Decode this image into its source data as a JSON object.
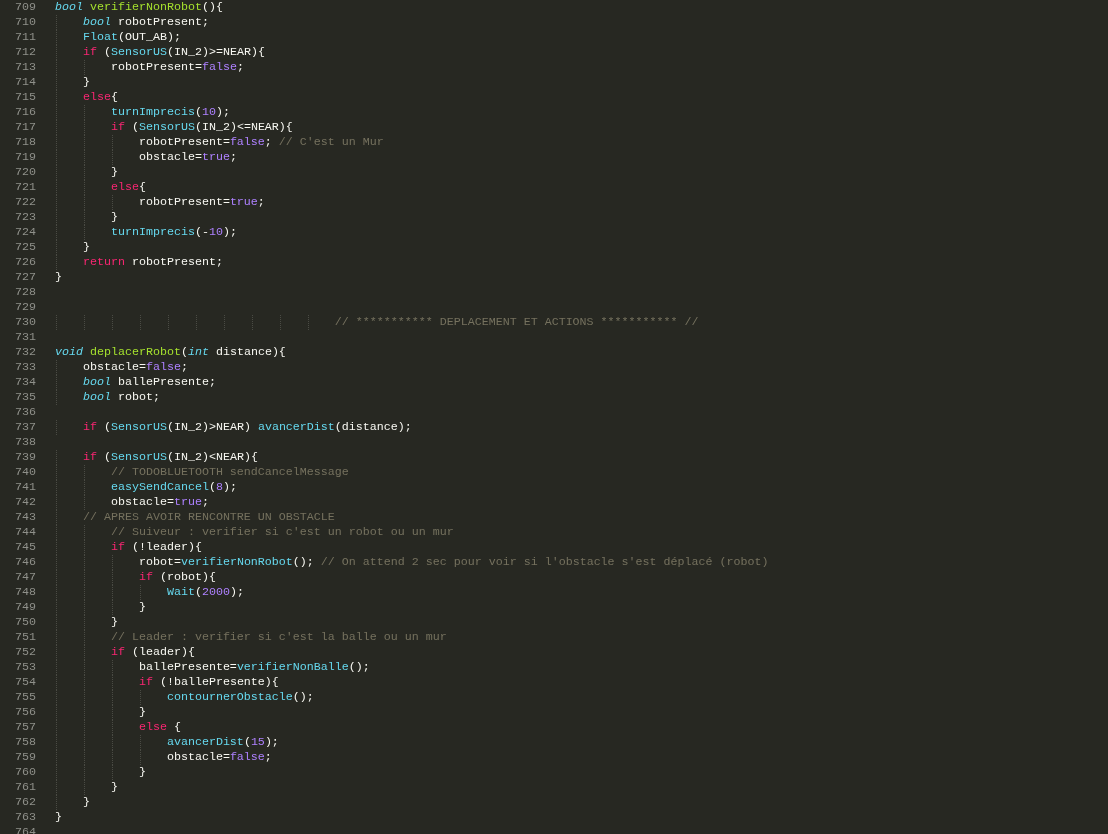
{
  "editor": {
    "lines": [
      {
        "number": "709",
        "tokens": [
          {
            "kind": "type",
            "text": "bool"
          },
          {
            "kind": "def",
            "text": " verifierNonRobot"
          },
          {
            "kind": "plain",
            "text": "(){"
          }
        ]
      },
      {
        "number": "710",
        "tokens": [
          {
            "kind": "type",
            "text": "    bool"
          },
          {
            "kind": "plain",
            "text": " robotPresent;"
          }
        ]
      },
      {
        "number": "711",
        "tokens": [
          {
            "kind": "fn",
            "text": "    Float"
          },
          {
            "kind": "plain",
            "text": "(OUT_AB);"
          }
        ]
      },
      {
        "number": "712",
        "tokens": [
          {
            "kind": "kw",
            "text": "    if"
          },
          {
            "kind": "plain",
            "text": " ("
          },
          {
            "kind": "fn",
            "text": "SensorUS"
          },
          {
            "kind": "plain",
            "text": "(IN_2)>=NEAR){"
          }
        ]
      },
      {
        "number": "713",
        "tokens": [
          {
            "kind": "plain",
            "text": "        robotPresent="
          },
          {
            "kind": "const",
            "text": "false"
          },
          {
            "kind": "plain",
            "text": ";"
          }
        ]
      },
      {
        "number": "714",
        "tokens": [
          {
            "kind": "plain",
            "text": "    }"
          }
        ]
      },
      {
        "number": "715",
        "tokens": [
          {
            "kind": "kw",
            "text": "    else"
          },
          {
            "kind": "plain",
            "text": "{"
          }
        ]
      },
      {
        "number": "716",
        "tokens": [
          {
            "kind": "fn",
            "text": "        turnImprecis"
          },
          {
            "kind": "plain",
            "text": "("
          },
          {
            "kind": "const",
            "text": "10"
          },
          {
            "kind": "plain",
            "text": ");"
          }
        ]
      },
      {
        "number": "717",
        "tokens": [
          {
            "kind": "kw",
            "text": "        if"
          },
          {
            "kind": "plain",
            "text": " ("
          },
          {
            "kind": "fn",
            "text": "SensorUS"
          },
          {
            "kind": "plain",
            "text": "(IN_2)<=NEAR){"
          }
        ]
      },
      {
        "number": "718",
        "tokens": [
          {
            "kind": "plain",
            "text": "            robotPresent="
          },
          {
            "kind": "const",
            "text": "false"
          },
          {
            "kind": "plain",
            "text": "; "
          },
          {
            "kind": "comment",
            "text": "// C'est un Mur"
          }
        ]
      },
      {
        "number": "719",
        "tokens": [
          {
            "kind": "plain",
            "text": "            obstacle="
          },
          {
            "kind": "const",
            "text": "true"
          },
          {
            "kind": "plain",
            "text": ";"
          }
        ]
      },
      {
        "number": "720",
        "tokens": [
          {
            "kind": "plain",
            "text": "        }"
          }
        ]
      },
      {
        "number": "721",
        "tokens": [
          {
            "kind": "kw",
            "text": "        else"
          },
          {
            "kind": "plain",
            "text": "{"
          }
        ]
      },
      {
        "number": "722",
        "tokens": [
          {
            "kind": "plain",
            "text": "            robotPresent="
          },
          {
            "kind": "const",
            "text": "true"
          },
          {
            "kind": "plain",
            "text": ";"
          }
        ]
      },
      {
        "number": "723",
        "tokens": [
          {
            "kind": "plain",
            "text": "        }"
          }
        ]
      },
      {
        "number": "724",
        "tokens": [
          {
            "kind": "fn",
            "text": "        turnImprecis"
          },
          {
            "kind": "plain",
            "text": "(-"
          },
          {
            "kind": "const",
            "text": "10"
          },
          {
            "kind": "plain",
            "text": ");"
          }
        ]
      },
      {
        "number": "725",
        "tokens": [
          {
            "kind": "plain",
            "text": "    }"
          }
        ]
      },
      {
        "number": "726",
        "tokens": [
          {
            "kind": "kw",
            "text": "    return"
          },
          {
            "kind": "plain",
            "text": " robotPresent;"
          }
        ]
      },
      {
        "number": "727",
        "tokens": [
          {
            "kind": "plain",
            "text": "}"
          }
        ]
      },
      {
        "number": "728"
      },
      {
        "number": "729"
      },
      {
        "number": "730",
        "tokens": [
          {
            "kind": "comment",
            "text": "                                        // *********** DEPLACEMENT ET ACTIONS *********** //"
          }
        ]
      },
      {
        "number": "731"
      },
      {
        "number": "732",
        "tokens": [
          {
            "kind": "type",
            "text": "void"
          },
          {
            "kind": "def",
            "text": " deplacerRobot"
          },
          {
            "kind": "plain",
            "text": "("
          },
          {
            "kind": "type",
            "text": "int"
          },
          {
            "kind": "plain",
            "text": " distance){"
          }
        ]
      },
      {
        "number": "733",
        "tokens": [
          {
            "kind": "plain",
            "text": "    obstacle="
          },
          {
            "kind": "const",
            "text": "false"
          },
          {
            "kind": "plain",
            "text": ";"
          }
        ]
      },
      {
        "number": "734",
        "tokens": [
          {
            "kind": "type",
            "text": "    bool"
          },
          {
            "kind": "plain",
            "text": " ballePresente;"
          }
        ]
      },
      {
        "number": "735",
        "tokens": [
          {
            "kind": "type",
            "text": "    bool"
          },
          {
            "kind": "plain",
            "text": " robot;"
          }
        ]
      },
      {
        "number": "736"
      },
      {
        "number": "737",
        "tokens": [
          {
            "kind": "kw",
            "text": "    if"
          },
          {
            "kind": "plain",
            "text": " ("
          },
          {
            "kind": "fn",
            "text": "SensorUS"
          },
          {
            "kind": "plain",
            "text": "(IN_2)>NEAR) "
          },
          {
            "kind": "fn",
            "text": "avancerDist"
          },
          {
            "kind": "plain",
            "text": "(distance);"
          }
        ]
      },
      {
        "number": "738"
      },
      {
        "number": "739",
        "tokens": [
          {
            "kind": "kw",
            "text": "    if"
          },
          {
            "kind": "plain",
            "text": " ("
          },
          {
            "kind": "fn",
            "text": "SensorUS"
          },
          {
            "kind": "plain",
            "text": "(IN_2)<NEAR){"
          }
        ]
      },
      {
        "number": "740",
        "tokens": [
          {
            "kind": "comment",
            "text": "        // TODOBLUETOOTH sendCancelMessage"
          }
        ]
      },
      {
        "number": "741",
        "tokens": [
          {
            "kind": "fn",
            "text": "        easySendCancel"
          },
          {
            "kind": "plain",
            "text": "("
          },
          {
            "kind": "const",
            "text": "8"
          },
          {
            "kind": "plain",
            "text": ");"
          }
        ]
      },
      {
        "number": "742",
        "tokens": [
          {
            "kind": "plain",
            "text": "        obstacle="
          },
          {
            "kind": "const",
            "text": "true"
          },
          {
            "kind": "plain",
            "text": ";"
          }
        ]
      },
      {
        "number": "743",
        "tokens": [
          {
            "kind": "comment",
            "text": "    // APRES AVOIR RENCONTRE UN OBSTACLE"
          }
        ]
      },
      {
        "number": "744",
        "tokens": [
          {
            "kind": "comment",
            "text": "        // Suiveur : verifier si c'est un robot ou un mur"
          }
        ]
      },
      {
        "number": "745",
        "tokens": [
          {
            "kind": "kw",
            "text": "        if"
          },
          {
            "kind": "plain",
            "text": " (!leader){"
          }
        ]
      },
      {
        "number": "746",
        "tokens": [
          {
            "kind": "plain",
            "text": "            robot="
          },
          {
            "kind": "fn",
            "text": "verifierNonRobot"
          },
          {
            "kind": "plain",
            "text": "(); "
          },
          {
            "kind": "comment",
            "text": "// On attend 2 sec pour voir si l'obstacle s'est déplacé (robot)"
          }
        ]
      },
      {
        "number": "747",
        "tokens": [
          {
            "kind": "kw",
            "text": "            if"
          },
          {
            "kind": "plain",
            "text": " (robot){"
          }
        ]
      },
      {
        "number": "748",
        "tokens": [
          {
            "kind": "fn",
            "text": "                Wait"
          },
          {
            "kind": "plain",
            "text": "("
          },
          {
            "kind": "const",
            "text": "2000"
          },
          {
            "kind": "plain",
            "text": ");"
          }
        ]
      },
      {
        "number": "749",
        "tokens": [
          {
            "kind": "plain",
            "text": "            }"
          }
        ]
      },
      {
        "number": "750",
        "tokens": [
          {
            "kind": "plain",
            "text": "        }"
          }
        ]
      },
      {
        "number": "751",
        "tokens": [
          {
            "kind": "comment",
            "text": "        // Leader : verifier si c'est la balle ou un mur"
          }
        ]
      },
      {
        "number": "752",
        "tokens": [
          {
            "kind": "kw",
            "text": "        if"
          },
          {
            "kind": "plain",
            "text": " (leader){"
          }
        ]
      },
      {
        "number": "753",
        "tokens": [
          {
            "kind": "plain",
            "text": "            ballePresente="
          },
          {
            "kind": "fn",
            "text": "verifierNonBalle"
          },
          {
            "kind": "plain",
            "text": "();"
          }
        ]
      },
      {
        "number": "754",
        "tokens": [
          {
            "kind": "kw",
            "text": "            if"
          },
          {
            "kind": "plain",
            "text": " (!ballePresente){"
          }
        ]
      },
      {
        "number": "755",
        "tokens": [
          {
            "kind": "fn",
            "text": "                contournerObstacle"
          },
          {
            "kind": "plain",
            "text": "();"
          }
        ]
      },
      {
        "number": "756",
        "tokens": [
          {
            "kind": "plain",
            "text": "            }"
          }
        ]
      },
      {
        "number": "757",
        "tokens": [
          {
            "kind": "kw",
            "text": "            else"
          },
          {
            "kind": "plain",
            "text": " {"
          }
        ]
      },
      {
        "number": "758",
        "tokens": [
          {
            "kind": "fn",
            "text": "                avancerDist"
          },
          {
            "kind": "plain",
            "text": "("
          },
          {
            "kind": "const",
            "text": "15"
          },
          {
            "kind": "plain",
            "text": ");"
          }
        ]
      },
      {
        "number": "759",
        "tokens": [
          {
            "kind": "plain",
            "text": "                obstacle="
          },
          {
            "kind": "const",
            "text": "false"
          },
          {
            "kind": "plain",
            "text": ";"
          }
        ]
      },
      {
        "number": "760",
        "tokens": [
          {
            "kind": "plain",
            "text": "            }"
          }
        ]
      },
      {
        "number": "761",
        "tokens": [
          {
            "kind": "plain",
            "text": "        }"
          }
        ]
      },
      {
        "number": "762",
        "tokens": [
          {
            "kind": "plain",
            "text": "    }"
          }
        ]
      },
      {
        "number": "763",
        "tokens": [
          {
            "kind": "plain",
            "text": "}"
          }
        ]
      },
      {
        "number": "764"
      }
    ]
  }
}
